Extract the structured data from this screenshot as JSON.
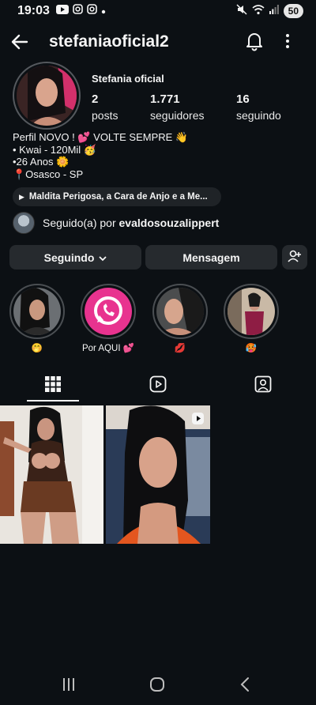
{
  "status": {
    "time": "19:03",
    "battery": "50"
  },
  "header": {
    "username": "stefaniaoficial2"
  },
  "profile": {
    "display_name": "Stefania oficial",
    "stats": [
      {
        "value": "2",
        "label": "posts"
      },
      {
        "value": "1.771",
        "label": "seguidores"
      },
      {
        "value": "16",
        "label": "seguindo"
      }
    ],
    "bio": [
      "Perfil NOVO ! 💕 VOLTE SEMPRE 👋",
      "• Kwai - 120Mil 🥳",
      "•26 Anos 🌼",
      "📍Osasco - SP"
    ],
    "music": "Maldita Perigosa, a Cara de Anjo e a Me..."
  },
  "followed_by": {
    "prefix": "Seguido(a) por",
    "user": "evaldosouzalippert"
  },
  "actions": {
    "follow_label": "Seguindo",
    "message_label": "Mensagem"
  },
  "highlights": [
    {
      "label": "🤭"
    },
    {
      "label": "Por AQUI 💕"
    },
    {
      "label": "💋"
    },
    {
      "label": "🥵"
    }
  ],
  "colors": {
    "background": "#0c1014",
    "button": "#262a2e",
    "whatsapp_pink": "#e8338f"
  },
  "icons": {
    "tab_grid": "grid-icon",
    "tab_reels": "reels-icon",
    "tab_tagged": "tagged-icon"
  }
}
